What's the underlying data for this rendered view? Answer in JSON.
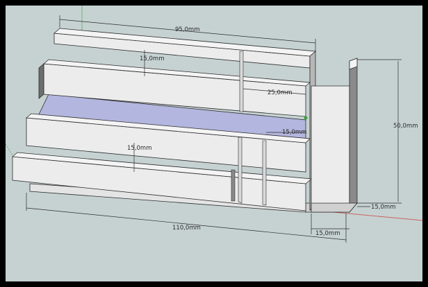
{
  "viewport": {
    "background": "#c6d2d2",
    "frame_color": "#000000"
  },
  "model": {
    "panel_fill": "#ececec",
    "panel_side": "#b7b7b7",
    "panel_dark": "#6e6e6e",
    "selected_face": "#b3b6de",
    "edge_color": "#2a2a2a"
  },
  "axes": {
    "red": "#cc3333",
    "green": "#3aa13a",
    "blue": "#3b5fd6"
  },
  "dimensions": {
    "top_width": "95,0mm",
    "inner_gap_top": "15,0mm",
    "right_section": "25,0mm",
    "small_gap": "15,0mm",
    "inner_gap_mid": "15,0mm",
    "height": "50,0mm",
    "bottom_width": "110,0mm",
    "base_depth": "15,0mm",
    "base_width": "15,0mm"
  }
}
